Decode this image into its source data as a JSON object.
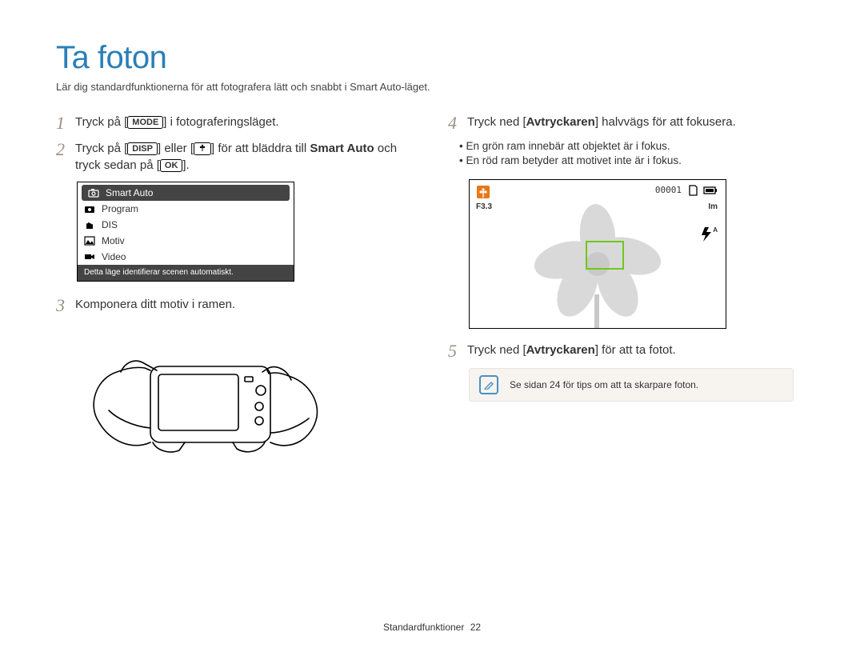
{
  "title": "Ta foton",
  "intro": "Lär dig standardfunktionerna för att fotografera lätt och snabbt i Smart Auto-läget.",
  "left": {
    "step1": {
      "num": "1",
      "pre": "Tryck på [",
      "btn": "MODE",
      "post": "] i fotograferingsläget."
    },
    "step2": {
      "num": "2",
      "pre": "Tryck på [",
      "btn1": "DISP",
      "mid": "] eller [",
      "btn2_alt": "macro-icon",
      "mid2": "] för att bläddra till ",
      "bold": "Smart Auto",
      "line2_pre": " och tryck sedan på [",
      "btn3": "OK",
      "line2_post": "]."
    },
    "menu": {
      "items": [
        "Smart Auto",
        "Program",
        "DIS",
        "Motiv",
        "Video"
      ],
      "desc": "Detta läge identifierar scenen automatiskt."
    },
    "step3": {
      "num": "3",
      "text": "Komponera ditt motiv i ramen."
    }
  },
  "right": {
    "step4": {
      "num": "4",
      "pre": "Tryck ned [",
      "bold": "Avtryckaren",
      "post": "] halvvägs för att fokusera."
    },
    "bullets": [
      "En grön ram innebär att objektet är i fokus.",
      "En röd ram betyder att motivet inte är i fokus."
    ],
    "preview": {
      "counter": "00001",
      "fstop": "F3.3",
      "size": "Im",
      "flash": "ƒA"
    },
    "step5": {
      "num": "5",
      "pre": "Tryck ned [",
      "bold": "Avtryckaren",
      "post": "] för att ta fotot."
    },
    "tip": "Se sidan 24 för tips om att ta skarpare foton."
  },
  "footer": {
    "section": "Standardfunktioner",
    "page": "22"
  }
}
